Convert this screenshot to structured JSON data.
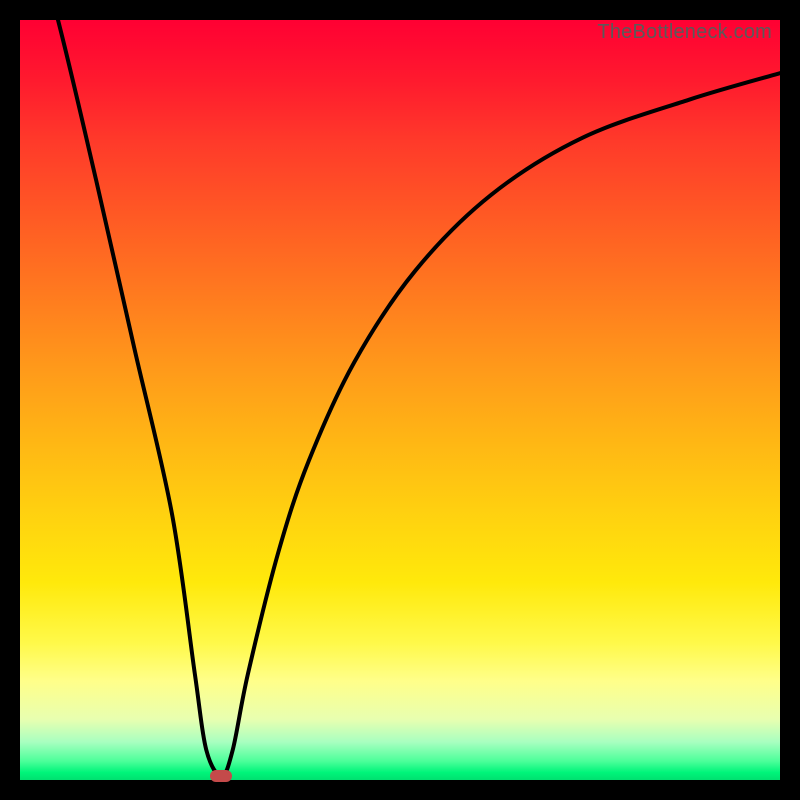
{
  "attribution": "TheBottleneck.com",
  "chart_data": {
    "type": "line",
    "title": "",
    "xlabel": "",
    "ylabel": "",
    "xlim": [
      0,
      100
    ],
    "ylim": [
      0,
      100
    ],
    "grid": false,
    "background_gradient": {
      "top": "#ff0033",
      "middle": "#ffd40f",
      "bottom": "#00e070"
    },
    "series": [
      {
        "name": "bottleneck-curve",
        "x": [
          0,
          5,
          10,
          15,
          20,
          23,
          24.5,
          26.5,
          28,
          30,
          34,
          38,
          44,
          52,
          62,
          74,
          88,
          100
        ],
        "y": [
          118,
          100,
          79,
          57,
          35,
          14,
          4,
          0.5,
          4,
          14,
          30,
          42,
          55,
          67,
          77,
          84.5,
          89.5,
          93
        ]
      }
    ],
    "marker": {
      "name": "red-lozenge",
      "x": 26.5,
      "y": 0.5,
      "color": "#c44a4a"
    }
  }
}
